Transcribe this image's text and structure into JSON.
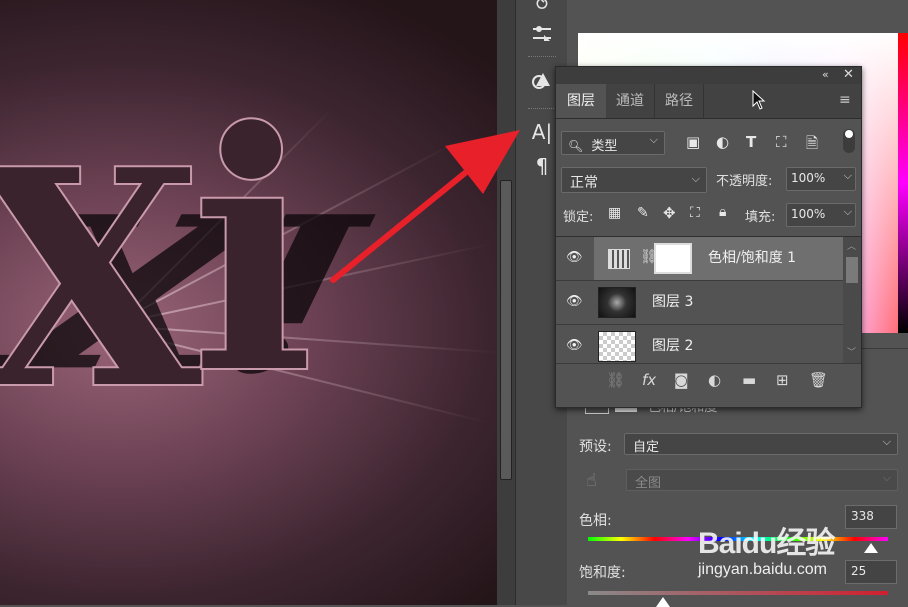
{
  "canvas": {
    "letters": [
      "X",
      "i"
    ]
  },
  "layers_panel": {
    "tabs": [
      {
        "label": "图层",
        "active": true
      },
      {
        "label": "通道",
        "active": false
      },
      {
        "label": "路径",
        "active": false
      }
    ],
    "filter": {
      "label": "类型"
    },
    "blend_mode": "正常",
    "opacity_label": "不透明度:",
    "opacity_value": "100%",
    "lock_label": "锁定:",
    "fill_label": "填充:",
    "fill_value": "100%",
    "layers": [
      {
        "name": "色相/饱和度 1",
        "visible": true,
        "selected": true,
        "type": "adjustment"
      },
      {
        "name": "图层 3",
        "visible": true,
        "selected": false,
        "type": "pixel"
      },
      {
        "name": "图层 2",
        "visible": true,
        "selected": false,
        "type": "transparent"
      }
    ]
  },
  "properties": {
    "title_partial": "色相/饱和度",
    "preset_label": "预设:",
    "preset_value": "自定",
    "channel_value": "全图",
    "hue_label": "色相:",
    "hue_value": "338",
    "saturation_label": "饱和度:",
    "saturation_value": "25"
  },
  "watermark": {
    "text": "Baidu经验",
    "url": "jingyan.baidu.com"
  },
  "colors": {
    "arrow": "#e8202a",
    "panel_bg": "#535353",
    "selected_row": "#6f6f6f"
  }
}
